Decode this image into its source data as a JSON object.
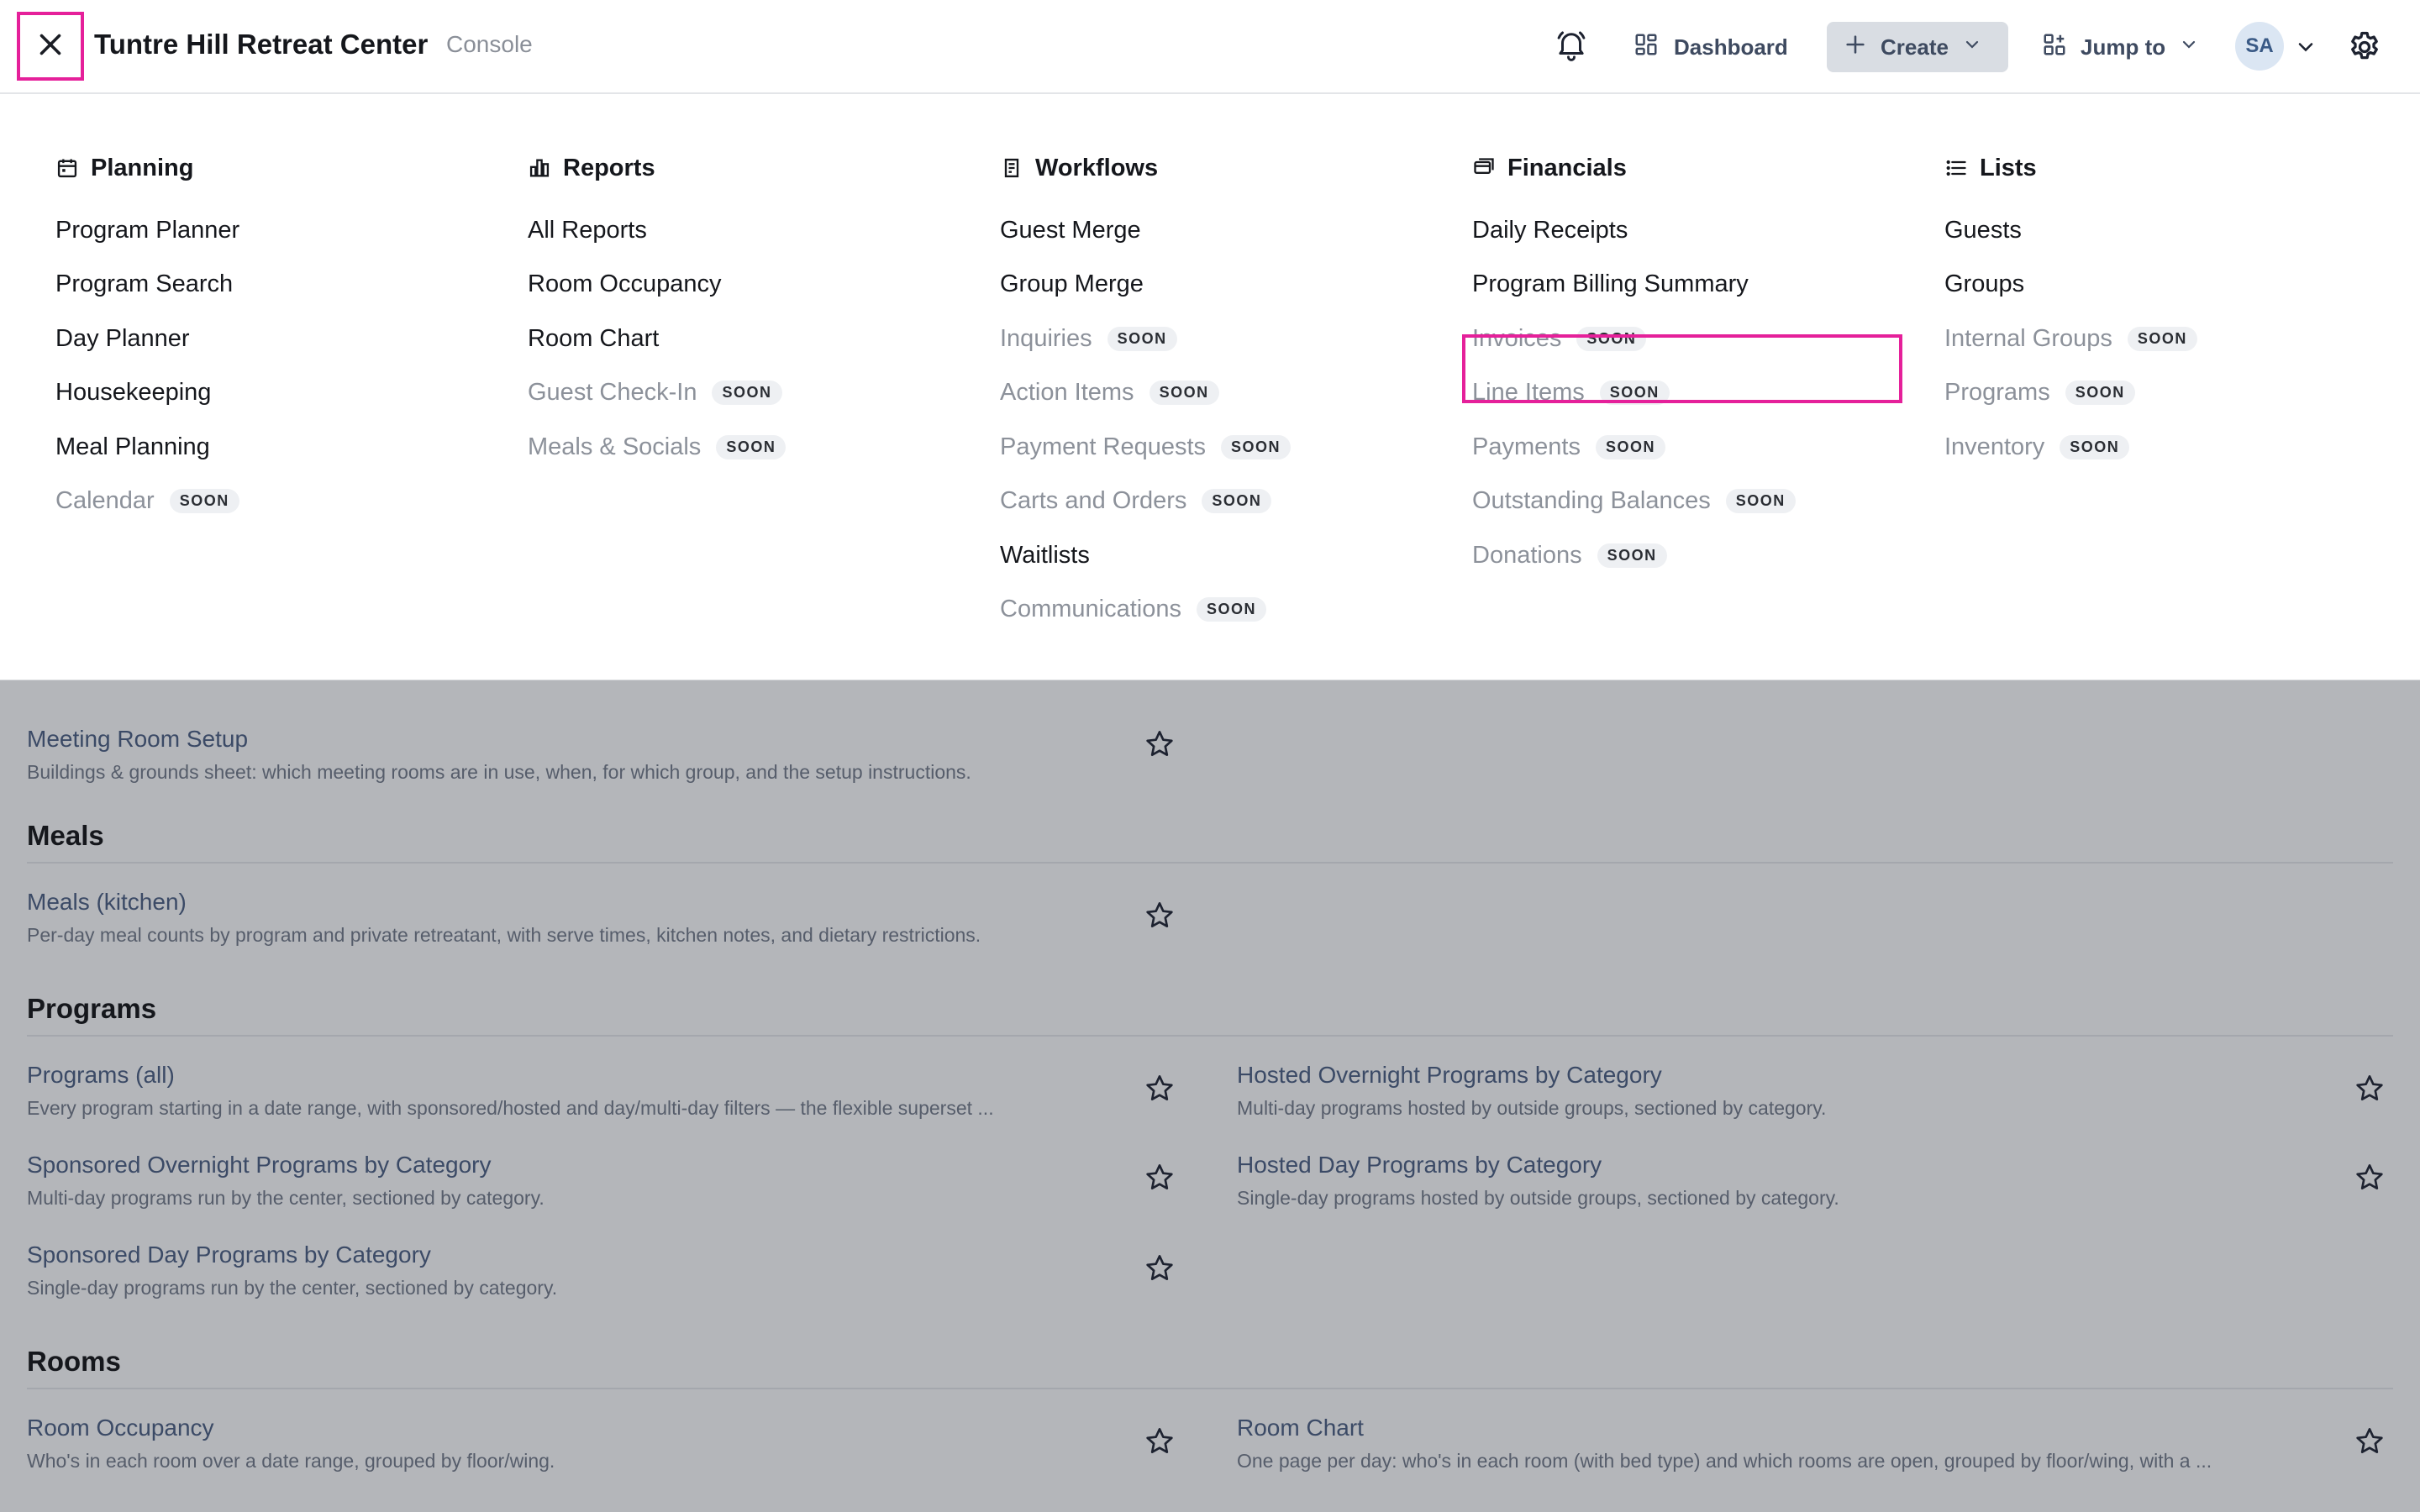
{
  "app": {
    "title": "Tuntre Hill Retreat Center",
    "subtitle": "Console"
  },
  "topbar": {
    "close_icon": "close-icon",
    "notifications_icon": "bell-icon",
    "dashboard_label": "Dashboard",
    "create_label": "Create",
    "jump_label": "Jump to",
    "avatar_initials": "SA",
    "settings_icon": "gear-icon"
  },
  "menu": {
    "soon_label": "SOON",
    "columns": [
      {
        "heading": "Planning",
        "icon": "calendar-icon",
        "items": [
          {
            "label": "Program Planner",
            "soon": false
          },
          {
            "label": "Program Search",
            "soon": false
          },
          {
            "label": "Day Planner",
            "soon": false
          },
          {
            "label": "Housekeeping",
            "soon": false
          },
          {
            "label": "Meal Planning",
            "soon": false
          },
          {
            "label": "Calendar",
            "soon": true
          }
        ]
      },
      {
        "heading": "Reports",
        "icon": "bar-chart-icon",
        "items": [
          {
            "label": "All Reports",
            "soon": false
          },
          {
            "label": "Room Occupancy",
            "soon": false
          },
          {
            "label": "Room Chart",
            "soon": false
          },
          {
            "label": "Guest Check-In",
            "soon": true
          },
          {
            "label": "Meals & Socials",
            "soon": true
          }
        ]
      },
      {
        "heading": "Workflows",
        "icon": "clipboard-icon",
        "items": [
          {
            "label": "Guest Merge",
            "soon": false
          },
          {
            "label": "Group Merge",
            "soon": false
          },
          {
            "label": "Inquiries",
            "soon": true
          },
          {
            "label": "Action Items",
            "soon": true
          },
          {
            "label": "Payment Requests",
            "soon": true
          },
          {
            "label": "Carts and Orders",
            "soon": true
          },
          {
            "label": "Waitlists",
            "soon": false
          },
          {
            "label": "Communications",
            "soon": true
          }
        ]
      },
      {
        "heading": "Financials",
        "icon": "cards-icon",
        "items": [
          {
            "label": "Daily Receipts",
            "soon": false
          },
          {
            "label": "Program Billing Summary",
            "soon": false
          },
          {
            "label": "Invoices",
            "soon": true
          },
          {
            "label": "Line Items",
            "soon": true
          },
          {
            "label": "Payments",
            "soon": true
          },
          {
            "label": "Outstanding Balances",
            "soon": true
          },
          {
            "label": "Donations",
            "soon": true
          }
        ]
      },
      {
        "heading": "Lists",
        "icon": "list-icon",
        "items": [
          {
            "label": "Guests",
            "soon": false
          },
          {
            "label": "Groups",
            "soon": false
          },
          {
            "label": "Internal Groups",
            "soon": true
          },
          {
            "label": "Programs",
            "soon": true
          },
          {
            "label": "Inventory",
            "soon": true
          }
        ]
      }
    ]
  },
  "background": {
    "sections": [
      {
        "title": "Meals"
      },
      {
        "title": "Programs"
      },
      {
        "title": "Rooms"
      }
    ],
    "reports": [
      {
        "title": "Meeting Room Setup",
        "desc": "Buildings & grounds sheet: which meeting rooms are in use, when, for which group, and the setup instructions."
      },
      {
        "title": "Meals (kitchen)",
        "desc": "Per-day meal counts by program and private retreatant, with serve times, kitchen notes, and dietary restrictions."
      },
      {
        "title": "Programs (all)",
        "desc": "Every program starting in a date range, with sponsored/hosted and day/multi-day filters — the flexible superset ..."
      },
      {
        "title": "Hosted Overnight Programs by Category",
        "desc": "Multi-day programs hosted by outside groups, sectioned by category."
      },
      {
        "title": "Sponsored Overnight Programs by Category",
        "desc": "Multi-day programs run by the center, sectioned by category."
      },
      {
        "title": "Hosted Day Programs by Category",
        "desc": "Single-day programs hosted by outside groups, sectioned by category."
      },
      {
        "title": "Sponsored Day Programs by Category",
        "desc": "Single-day programs run by the center, sectioned by category."
      },
      {
        "title": "Room Occupancy",
        "desc": "Who's in each room over a date range, grouped by floor/wing."
      },
      {
        "title": "Room Chart",
        "desc": "One page per day: who's in each room (with bed type) and which rooms are open, grouped by floor/wing, with a ..."
      }
    ]
  },
  "colors": {
    "highlight": "#e5209a",
    "overlay": "#b4b6ba",
    "link": "#3b4a66"
  }
}
